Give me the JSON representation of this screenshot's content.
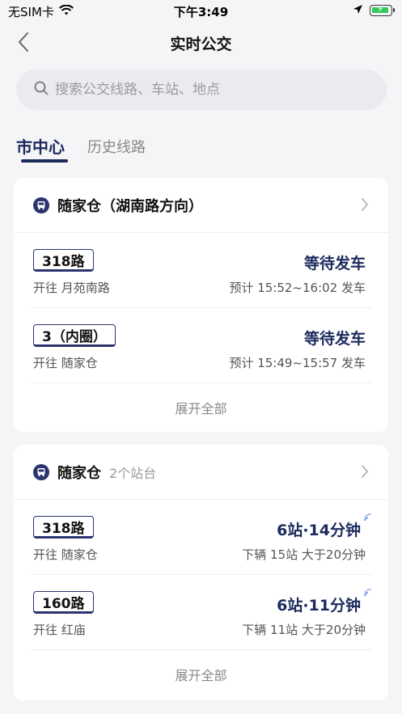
{
  "status_bar": {
    "carrier": "无SIM卡",
    "time": "下午3:49",
    "icons": [
      "wifi-icon",
      "location-arrow-icon",
      "battery-charging-icon"
    ]
  },
  "nav": {
    "title": "实时公交",
    "back_icon": "chevron-left-icon"
  },
  "search": {
    "placeholder": "搜索公交线路、车站、地点"
  },
  "tabs": [
    {
      "label": "市中心",
      "active": true
    },
    {
      "label": "历史线路",
      "active": false
    }
  ],
  "cards": [
    {
      "stop_name": "随家仓（湖南路方向）",
      "stop_sub": "",
      "routes": [
        {
          "badge": "318路",
          "dest": "开往 月苑南路",
          "status": "等待发车",
          "eta": "预计 15:52~16:02 发车"
        },
        {
          "badge": "3（内圈）",
          "dest": "开往 随家仓",
          "status": "等待发车",
          "eta": "预计 15:49~15:57 发车"
        }
      ],
      "expand_label": "展开全部"
    },
    {
      "stop_name": "随家仓",
      "stop_sub": "2个站台",
      "routes": [
        {
          "badge": "318路",
          "dest": "开往 随家仓",
          "status": "6站·14分钟",
          "eta": "下辆 15站 大于20分钟"
        },
        {
          "badge": "160路",
          "dest": "开往 红庙",
          "status": "6站·11分钟",
          "eta": "下辆 11站 大于20分钟"
        }
      ],
      "expand_label": "展开全部"
    }
  ],
  "colors": {
    "accent": "#1b2a5c",
    "background": "#f5f5f7",
    "card": "#ffffff"
  }
}
